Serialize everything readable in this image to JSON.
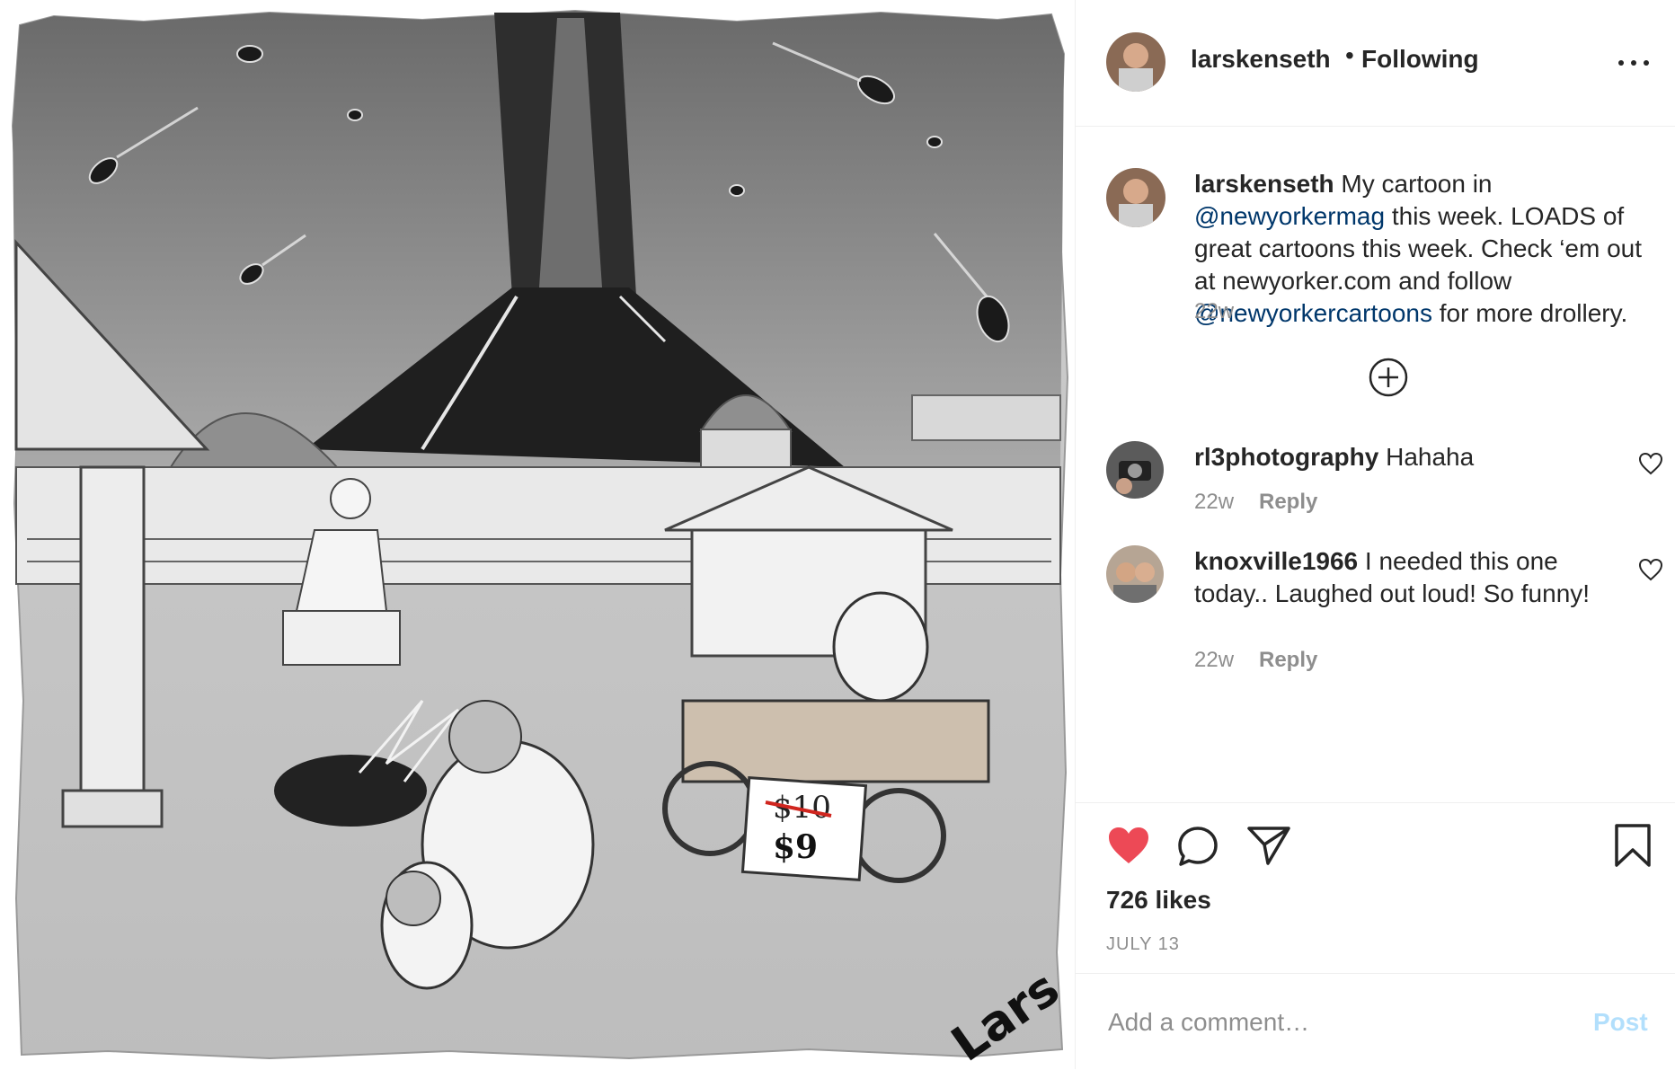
{
  "post": {
    "image": {
      "description_icon": "cartoon-image",
      "price_old": "$10",
      "price_new": "$9",
      "signature": "Lars"
    },
    "header": {
      "username": "larskenseth",
      "separator": "•",
      "follow_status": "Following",
      "more_icon": "more-horizontal-icon"
    },
    "caption": {
      "username": "larskenseth",
      "text_1": " My cartoon in ",
      "mention_1": "@newyorkermag",
      "text_2": " this week. LOADS of great cartoons this week. Check ‘em out at newyorker.com and follow ",
      "mention_2": "@newyorkercartoons",
      "text_3": " for more drollery.",
      "time": "22w"
    },
    "load_more_icon": "plus-circle-icon",
    "comments": [
      {
        "username": "rl3photography",
        "text": " Hahaha",
        "time": "22w",
        "reply": "Reply"
      },
      {
        "username": "knoxville1966",
        "text": " I needed this one today.. Laughed out loud! So funny!",
        "time": "22w",
        "reply": "Reply"
      }
    ],
    "actions": {
      "like_icon": "heart-filled-icon",
      "comment_icon": "comment-icon",
      "share_icon": "paper-plane-icon",
      "save_icon": "bookmark-icon",
      "likes": "726 likes",
      "date": "JULY 13"
    },
    "add_comment": {
      "placeholder": "Add a comment…",
      "post_label": "Post"
    },
    "colors": {
      "like_red": "#ed4956",
      "mention_blue": "#00376b",
      "post_disabled": "#b2dffc",
      "muted": "#8e8e8e"
    }
  }
}
